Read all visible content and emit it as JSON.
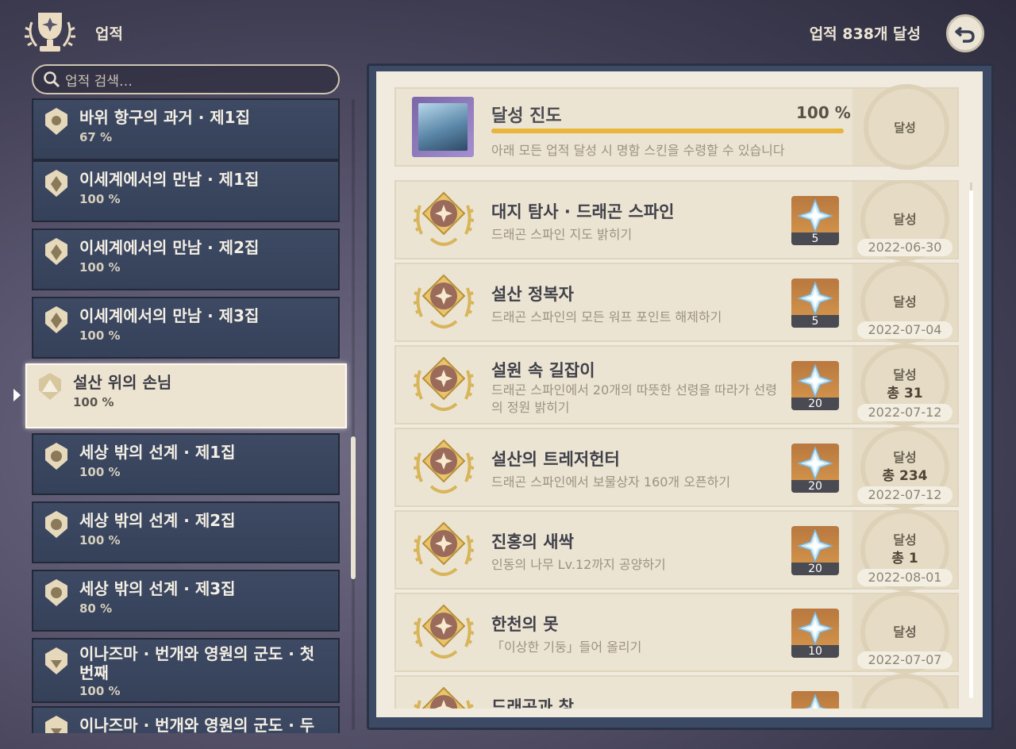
{
  "header": {
    "title": "업적",
    "count": "업적 838개 달성"
  },
  "search": {
    "placeholder": "업적 검색…"
  },
  "categories": [
    {
      "name": "바위 항구의 과거 · 제1집",
      "pct": "67 %"
    },
    {
      "name": "이세계에서의 만남 · 제1집",
      "pct": "100 %"
    },
    {
      "name": "이세계에서의 만남 · 제2집",
      "pct": "100 %"
    },
    {
      "name": "이세계에서의 만남 · 제3집",
      "pct": "100 %"
    },
    {
      "name": "설산 위의 손님",
      "pct": "100 %"
    },
    {
      "name": "세상 밖의 선계 · 제1집",
      "pct": "100 %"
    },
    {
      "name": "세상 밖의 선계 · 제2집",
      "pct": "100 %"
    },
    {
      "name": "세상 밖의 선계 · 제3집",
      "pct": "80 %"
    },
    {
      "name": "이나즈마 · 번개와 영원의 군도 · 첫 번째",
      "pct": "100 %"
    },
    {
      "name": "이나즈마 · 번개와 영원의 군도 · 두",
      "pct": ""
    }
  ],
  "progress": {
    "title": "달성 진도",
    "pct": "100 %",
    "value": 1.0,
    "desc": "아래 모든 업적 달성 시 명함 스킨을 수령할 수 있습니다",
    "stamp": "달성"
  },
  "achievements": [
    {
      "title": "대지 탐사 · 드래곤 스파인",
      "desc": "드래곤 스파인 지도 밝히기",
      "reward": "5",
      "stamp": "달성",
      "total": "",
      "date": "2022-06-30"
    },
    {
      "title": "설산 정복자",
      "desc": "드래곤 스파인의 모든 워프 포인트 해제하기",
      "reward": "5",
      "stamp": "달성",
      "total": "",
      "date": "2022-07-04"
    },
    {
      "title": "설원 속 길잡이",
      "desc": "드래곤 스파인에서 20개의 따뜻한 선령을 따라가 선령의 정원 밝히기",
      "reward": "20",
      "stamp": "달성",
      "total": "총 31",
      "date": "2022-07-12"
    },
    {
      "title": "설산의 트레저헌터",
      "desc": "드래곤 스파인에서 보물상자 160개 오픈하기",
      "reward": "20",
      "stamp": "달성",
      "total": "총 234",
      "date": "2022-07-12"
    },
    {
      "title": "진홍의 새싹",
      "desc": "인동의 나무 Lv.12까지 공양하기",
      "reward": "20",
      "stamp": "달성",
      "total": "총 1",
      "date": "2022-08-01"
    },
    {
      "title": "한천의 못",
      "desc": "「이상한 기둥」들어 올리기",
      "reward": "10",
      "stamp": "달성",
      "total": "",
      "date": "2022-07-07"
    },
    {
      "title": "드래곤과 창",
      "desc": "",
      "reward": "",
      "stamp": "",
      "total": "",
      "date": ""
    }
  ],
  "colors": {
    "accent": "#e8b43a",
    "panel": "#ece4d2",
    "category_bg": "#3e4a63"
  }
}
